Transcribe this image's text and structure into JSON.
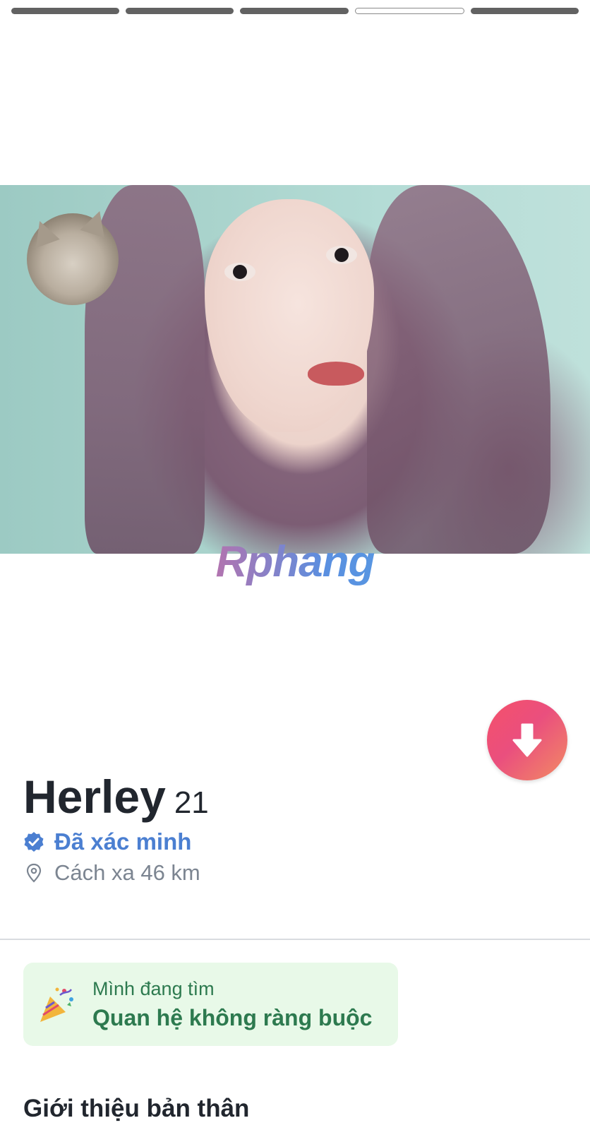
{
  "progress": {
    "segments": 5,
    "active_index": 3
  },
  "photo": {
    "description_icon": "profile-photo"
  },
  "watermark": {
    "text": "Rphang"
  },
  "profile": {
    "name": "Herley",
    "age": "21",
    "verified_label": "Đã xác minh",
    "distance_label": "Cách xa 46 km"
  },
  "looking_for": {
    "label": "Mình đang tìm",
    "value": "Quan hệ không ràng buộc",
    "icon": "party-popper-icon"
  },
  "sections": {
    "about_title": "Giới thiệu bản thân"
  },
  "colors": {
    "accent": "#ea4f7e",
    "verified": "#4b7fd1",
    "looking_bg": "#e8f9e8",
    "looking_text": "#2d7a4f"
  }
}
